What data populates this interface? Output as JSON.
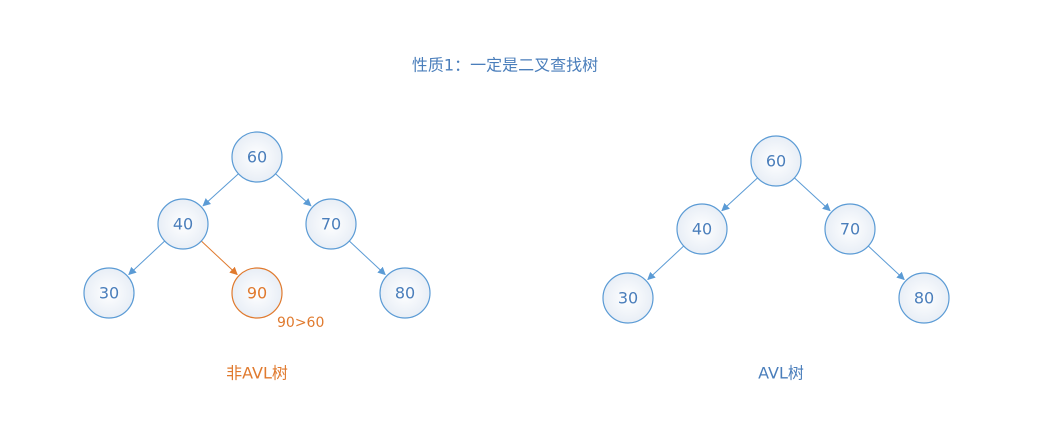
{
  "title": "性质1：一定是二叉查找树",
  "colors": {
    "blue": "#5B9BD5",
    "text_blue": "#4A7EBB",
    "orange": "#E07A2E",
    "node_fill_center": "#FFFFFF",
    "node_fill_edge": "#E8EEF6"
  },
  "trees": [
    {
      "id": "left",
      "caption": "非AVL树",
      "caption_color": "orange",
      "nodes": [
        {
          "id": "n60",
          "label": "60",
          "color": "blue"
        },
        {
          "id": "n40",
          "label": "40",
          "color": "blue"
        },
        {
          "id": "n70",
          "label": "70",
          "color": "blue"
        },
        {
          "id": "n30",
          "label": "30",
          "color": "blue"
        },
        {
          "id": "n90",
          "label": "90",
          "color": "orange"
        },
        {
          "id": "n80",
          "label": "80",
          "color": "blue"
        }
      ],
      "edges": [
        {
          "from": "n60",
          "to": "n40",
          "color": "blue"
        },
        {
          "from": "n60",
          "to": "n70",
          "color": "blue"
        },
        {
          "from": "n40",
          "to": "n30",
          "color": "blue"
        },
        {
          "from": "n40",
          "to": "n90",
          "color": "orange"
        },
        {
          "from": "n70",
          "to": "n80",
          "color": "blue"
        }
      ],
      "annotation": {
        "text": "90>60",
        "near": "n90",
        "color": "orange"
      }
    },
    {
      "id": "right",
      "caption": "AVL树",
      "caption_color": "blue",
      "nodes": [
        {
          "id": "m60",
          "label": "60",
          "color": "blue"
        },
        {
          "id": "m40",
          "label": "40",
          "color": "blue"
        },
        {
          "id": "m70",
          "label": "70",
          "color": "blue"
        },
        {
          "id": "m30",
          "label": "30",
          "color": "blue"
        },
        {
          "id": "m80",
          "label": "80",
          "color": "blue"
        }
      ],
      "edges": [
        {
          "from": "m60",
          "to": "m40",
          "color": "blue"
        },
        {
          "from": "m60",
          "to": "m70",
          "color": "blue"
        },
        {
          "from": "m40",
          "to": "m30",
          "color": "blue"
        },
        {
          "from": "m70",
          "to": "m80",
          "color": "blue"
        }
      ]
    }
  ]
}
